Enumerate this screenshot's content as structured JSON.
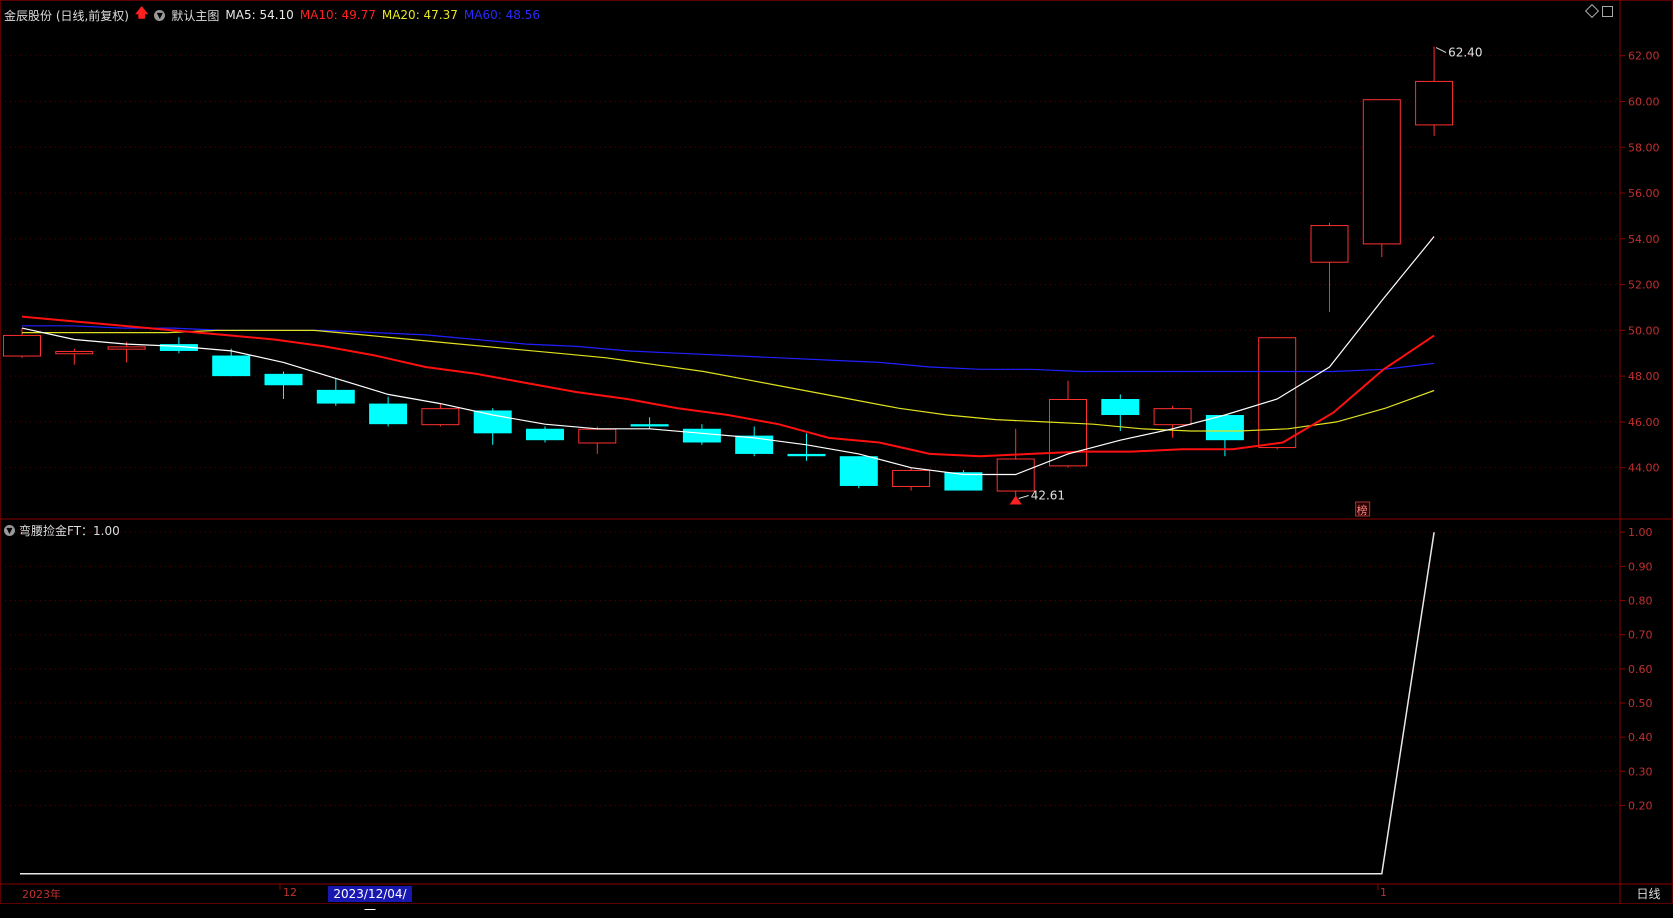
{
  "header": {
    "stock_title": "金辰股份 (日线,前复权)",
    "main_chart_label": "默认主图",
    "ma5_label": "MA5: 54.10",
    "ma10_label": "MA10: 49.77",
    "ma20_label": "MA20: 47.37",
    "ma60_label": "MA60: 48.56"
  },
  "indicator_header": {
    "label": "弯腰捡金FT：1.00"
  },
  "xaxis": {
    "year_label": "2023年",
    "month_label_12": "12",
    "selected_date": "2023/12/04/一",
    "month_label_1": "1",
    "period": "日线"
  },
  "annotations": {
    "high_label": "62.40",
    "low_label": "42.61",
    "badge": "榜"
  },
  "colors": {
    "up": "#ff3030",
    "down": "#00ffff",
    "ma5": "#ffffff",
    "ma10": "#ff1010",
    "ma20": "#e0e020",
    "ma60": "#2020ff",
    "grid": "#5a0000",
    "axis_text": "#c03030"
  },
  "chart_data": [
    {
      "type": "candlestick",
      "yticks": [
        44.0,
        46.0,
        48.0,
        50.0,
        52.0,
        54.0,
        56.0,
        58.0,
        60.0,
        62.0
      ],
      "ylim": [
        41.8,
        63.3
      ],
      "candles": [
        {
          "o": 48.9,
          "h": 50.1,
          "l": 48.8,
          "c": 49.8
        },
        {
          "o": 49.0,
          "h": 49.2,
          "l": 48.5,
          "c": 49.1
        },
        {
          "o": 49.2,
          "h": 49.5,
          "l": 48.6,
          "c": 49.3
        },
        {
          "o": 49.4,
          "h": 49.7,
          "l": 49.0,
          "c": 49.1
        },
        {
          "o": 48.9,
          "h": 49.2,
          "l": 48.0,
          "c": 48.0
        },
        {
          "o": 48.1,
          "h": 48.2,
          "l": 47.0,
          "c": 47.6
        },
        {
          "o": 47.4,
          "h": 47.9,
          "l": 46.7,
          "c": 46.8
        },
        {
          "o": 46.8,
          "h": 47.1,
          "l": 45.8,
          "c": 45.9
        },
        {
          "o": 45.9,
          "h": 46.8,
          "l": 45.8,
          "c": 46.6
        },
        {
          "o": 46.5,
          "h": 46.6,
          "l": 45.0,
          "c": 45.5
        },
        {
          "o": 45.7,
          "h": 45.8,
          "l": 45.1,
          "c": 45.2
        },
        {
          "o": 45.1,
          "h": 45.8,
          "l": 44.6,
          "c": 45.7
        },
        {
          "o": 45.9,
          "h": 46.2,
          "l": 45.7,
          "c": 45.8
        },
        {
          "o": 45.7,
          "h": 45.9,
          "l": 45.0,
          "c": 45.1
        },
        {
          "o": 45.4,
          "h": 45.8,
          "l": 44.5,
          "c": 44.6
        },
        {
          "o": 44.6,
          "h": 45.5,
          "l": 44.3,
          "c": 44.5
        },
        {
          "o": 44.5,
          "h": 44.5,
          "l": 43.1,
          "c": 43.2
        },
        {
          "o": 43.2,
          "h": 44.0,
          "l": 43.0,
          "c": 43.9
        },
        {
          "o": 43.8,
          "h": 43.9,
          "l": 43.0,
          "c": 43.0
        },
        {
          "o": 43.0,
          "h": 45.7,
          "l": 42.61,
          "c": 44.4
        },
        {
          "o": 44.1,
          "h": 47.8,
          "l": 44.0,
          "c": 47.0
        },
        {
          "o": 47.0,
          "h": 47.2,
          "l": 45.6,
          "c": 46.3
        },
        {
          "o": 45.9,
          "h": 46.7,
          "l": 45.3,
          "c": 46.6
        },
        {
          "o": 46.3,
          "h": 46.3,
          "l": 44.5,
          "c": 45.2
        },
        {
          "o": 44.9,
          "h": 49.7,
          "l": 44.8,
          "c": 49.7
        },
        {
          "o": 53.0,
          "h": 54.7,
          "l": 50.8,
          "c": 54.6
        },
        {
          "o": 53.8,
          "h": 60.1,
          "l": 53.2,
          "c": 60.1
        },
        {
          "o": 59.0,
          "h": 62.4,
          "l": 58.5,
          "c": 60.9
        }
      ],
      "ma5": [
        50.1,
        49.6,
        49.4,
        49.3,
        49.1,
        48.6,
        47.9,
        47.2,
        46.8,
        46.3,
        45.9,
        45.7,
        45.7,
        45.5,
        45.3,
        45.0,
        44.6,
        44.0,
        43.7,
        43.7,
        44.6,
        45.2,
        45.7,
        46.3,
        47.0,
        48.4,
        51.3,
        54.1
      ],
      "ma10": [
        50.6,
        50.4,
        50.2,
        50.0,
        49.8,
        49.6,
        49.3,
        48.9,
        48.4,
        48.1,
        47.7,
        47.3,
        47.0,
        46.6,
        46.3,
        45.9,
        45.3,
        45.1,
        44.6,
        44.5,
        44.6,
        44.7,
        44.7,
        44.8,
        44.8,
        45.1,
        46.4,
        48.3,
        49.77
      ],
      "ma20": [
        49.9,
        49.9,
        49.9,
        49.9,
        50.0,
        50.0,
        50.0,
        49.8,
        49.6,
        49.4,
        49.2,
        49.0,
        48.8,
        48.5,
        48.2,
        47.8,
        47.4,
        47.0,
        46.6,
        46.3,
        46.1,
        46.0,
        45.9,
        45.7,
        45.6,
        45.6,
        45.7,
        46.0,
        46.6,
        47.37
      ],
      "ma60": [
        50.2,
        50.2,
        50.1,
        50.1,
        50.0,
        50.0,
        50.0,
        49.9,
        49.8,
        49.6,
        49.4,
        49.3,
        49.1,
        49.0,
        48.9,
        48.8,
        48.7,
        48.6,
        48.4,
        48.3,
        48.3,
        48.2,
        48.2,
        48.2,
        48.2,
        48.2,
        48.2,
        48.3,
        48.56
      ]
    },
    {
      "type": "line",
      "name": "弯腰捡金FT",
      "yticks": [
        0.2,
        0.3,
        0.4,
        0.5,
        0.6,
        0.7,
        0.8,
        0.9,
        1.0
      ],
      "ylim": [
        -0.03,
        1.03
      ],
      "values": [
        0,
        0,
        0,
        0,
        0,
        0,
        0,
        0,
        0,
        0,
        0,
        0,
        0,
        0,
        0,
        0,
        0,
        0,
        0,
        0,
        0,
        0,
        0,
        0,
        0,
        0,
        0,
        1
      ]
    }
  ]
}
